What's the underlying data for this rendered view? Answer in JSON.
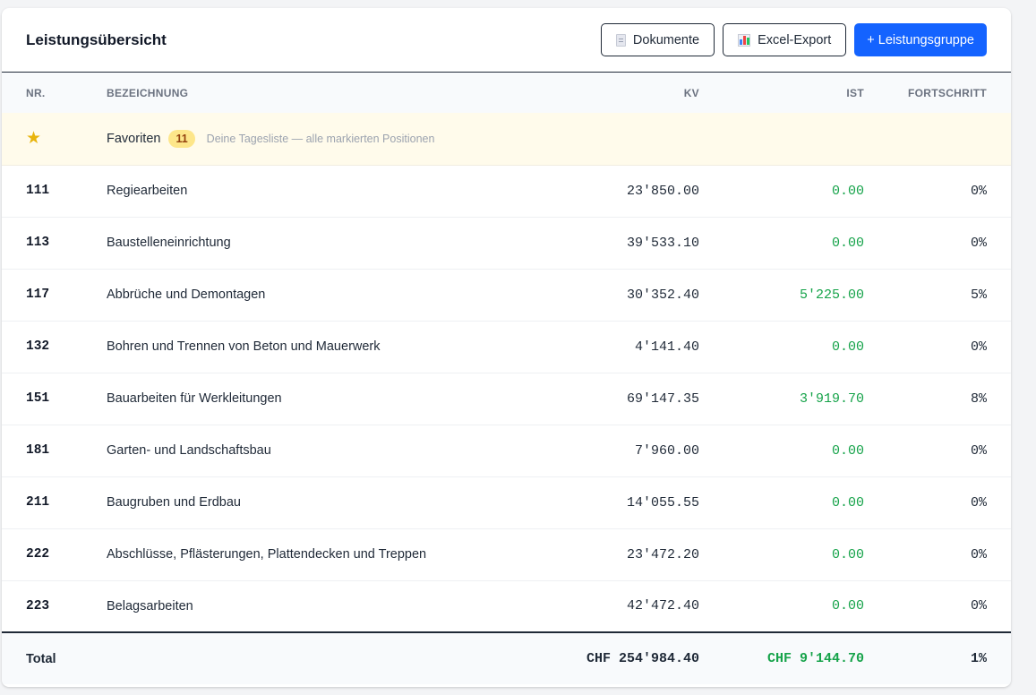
{
  "header": {
    "title": "Leistungsübersicht",
    "documents_label": "Dokumente",
    "excel_label": "Excel-Export",
    "add_group_label": "+ Leistungsgruppe"
  },
  "columns": {
    "nr": "NR.",
    "name": "BEZEICHNUNG",
    "kv": "KV",
    "ist": "IST",
    "progress": "FORTSCHRITT"
  },
  "favorites": {
    "label": "Favoriten",
    "count": "11",
    "description": "Deine Tagesliste — alle markierten Positionen"
  },
  "rows": [
    {
      "nr": "111",
      "name": "Regiearbeiten",
      "kv": "23'850.00",
      "ist": "0.00",
      "progress": "0%"
    },
    {
      "nr": "113",
      "name": "Baustelleneinrichtung",
      "kv": "39'533.10",
      "ist": "0.00",
      "progress": "0%"
    },
    {
      "nr": "117",
      "name": "Abbrüche und Demontagen",
      "kv": "30'352.40",
      "ist": "5'225.00",
      "progress": "5%"
    },
    {
      "nr": "132",
      "name": "Bohren und Trennen von Beton und Mauerwerk",
      "kv": "4'141.40",
      "ist": "0.00",
      "progress": "0%"
    },
    {
      "nr": "151",
      "name": "Bauarbeiten für Werkleitungen",
      "kv": "69'147.35",
      "ist": "3'919.70",
      "progress": "8%"
    },
    {
      "nr": "181",
      "name": "Garten- und Landschaftsbau",
      "kv": "7'960.00",
      "ist": "0.00",
      "progress": "0%"
    },
    {
      "nr": "211",
      "name": "Baugruben und Erdbau",
      "kv": "14'055.55",
      "ist": "0.00",
      "progress": "0%"
    },
    {
      "nr": "222",
      "name": "Abschlüsse, Pflästerungen, Plattendecken und Treppen",
      "kv": "23'472.20",
      "ist": "0.00",
      "progress": "0%"
    },
    {
      "nr": "223",
      "name": "Belagsarbeiten",
      "kv": "42'472.40",
      "ist": "0.00",
      "progress": "0%"
    }
  ],
  "total": {
    "label": "Total",
    "kv": "CHF 254'984.40",
    "ist": "CHF 9'144.70",
    "progress": "1%"
  },
  "colors": {
    "primary": "#1463ff",
    "ist_green": "#16a34a",
    "favorites_bg": "#fffbeb",
    "star": "#e8b40c"
  },
  "icons": [
    "document-icon",
    "spreadsheet-icon",
    "star-icon"
  ]
}
